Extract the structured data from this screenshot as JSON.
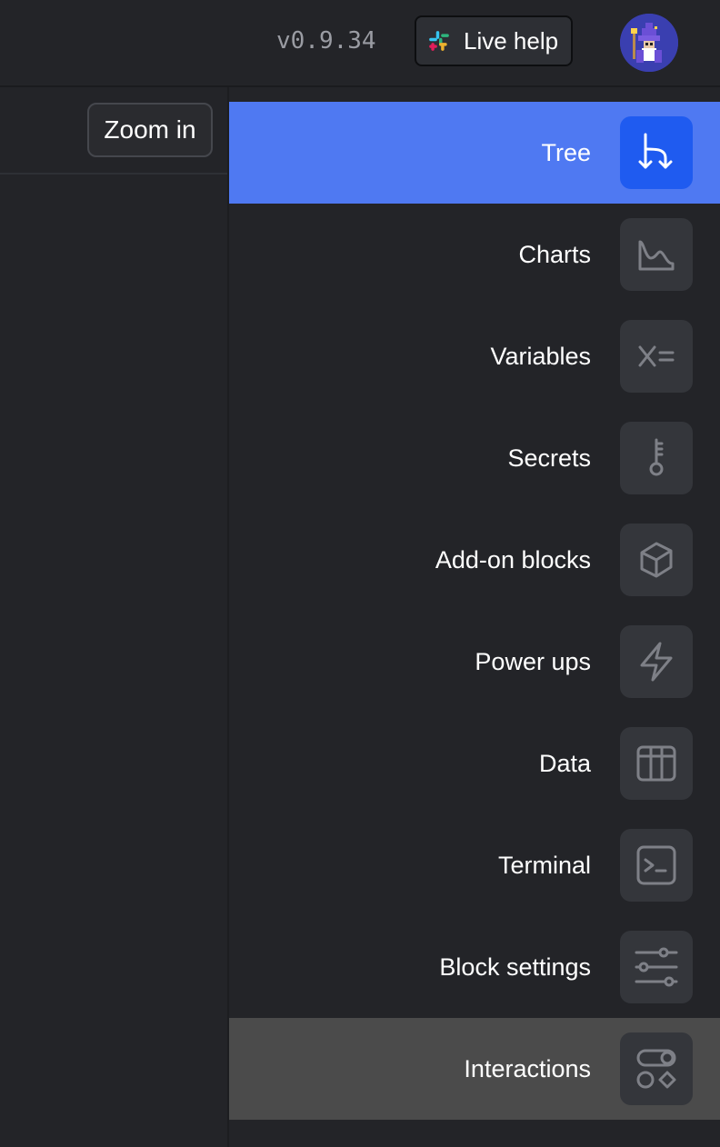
{
  "header": {
    "version": "v0.9.34",
    "live_help_label": "Live help"
  },
  "toolbar": {
    "zoom_in_label": "Zoom in"
  },
  "menu": {
    "items": [
      {
        "label": "Tree",
        "icon": "tree-branch-icon",
        "state": "active"
      },
      {
        "label": "Charts",
        "icon": "chart-line-icon"
      },
      {
        "label": "Variables",
        "icon": "variable-icon"
      },
      {
        "label": "Secrets",
        "icon": "key-icon"
      },
      {
        "label": "Add-on blocks",
        "icon": "cube-icon"
      },
      {
        "label": "Power ups",
        "icon": "lightning-icon"
      },
      {
        "label": "Data",
        "icon": "table-icon"
      },
      {
        "label": "Terminal",
        "icon": "terminal-icon"
      },
      {
        "label": "Block settings",
        "icon": "sliders-icon"
      },
      {
        "label": "Interactions",
        "icon": "toggle-shapes-icon",
        "state": "hovered"
      }
    ]
  },
  "colors": {
    "background": "#232428",
    "active": "#4f79f2",
    "active_icon_bg": "#1f5bf0",
    "hover": "#4b4b4b",
    "icon_bg": "#34363b",
    "icon_stroke": "#7e8087"
  }
}
